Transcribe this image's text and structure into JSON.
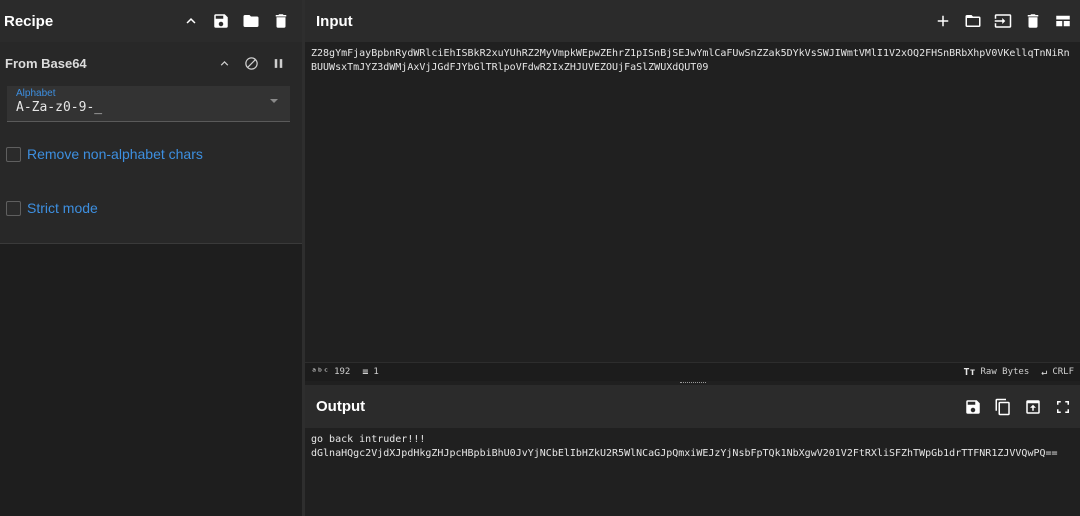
{
  "recipe": {
    "title": "Recipe",
    "icons": [
      "chevron-up-icon",
      "save-icon",
      "folder-icon",
      "trash-icon"
    ],
    "operation": {
      "title": "From Base64",
      "alphabet_label": "Alphabet",
      "alphabet_value": "A-Za-z0-9-_",
      "remove_non_alphabet_label": "Remove non-alphabet chars",
      "strict_mode_label": "Strict mode"
    }
  },
  "input": {
    "title": "Input",
    "text": "Z28gYmFjayBpbnRydWRlciEhISBkR2xuYUhRZ2MyVmpkWEpwZEhrZ1pISnBjSEJwYmlCaFUwSnZZak5DYkVsSWJIWmtVMlI1V2xOQ2FHSnBRbXhpV0VKellqTnNiRnBUUWsxTmJYZ3dWMjAxVjJGdFJYbGlTRlpoVFdwR2IxZHJUVEZOUjFaSlZWUXdQUT09",
    "status": {
      "chars": "192",
      "lines": "1",
      "encoding": "Raw Bytes",
      "eol": "CRLF"
    }
  },
  "output": {
    "title": "Output",
    "text": "go back intruder!!!\ndGlnaHQgc2VjdXJpdHkgZHJpcHBpbiBhU0JvYjNCbElIbHZkU2R5WlNCaGJpQmxiWEJzYjNsbFpTQk1NbXgwV201V2FtRXliSFZhTWpGb1drTTFNR1ZJVVQwPQ=="
  },
  "colors": {
    "accent": "#3d8fe0",
    "background": "#202020",
    "header": "#2b2b2b"
  }
}
